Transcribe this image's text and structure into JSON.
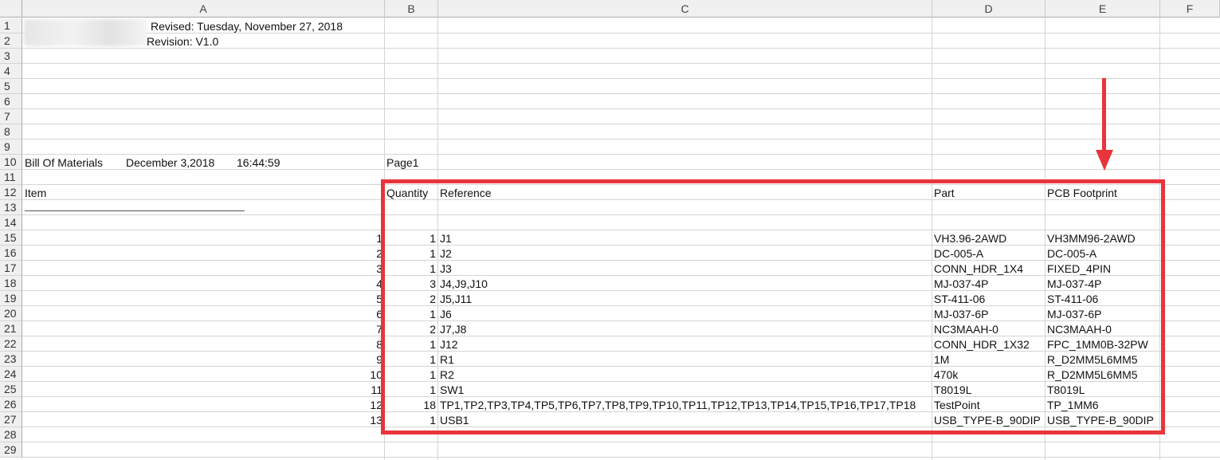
{
  "columns": [
    "A",
    "B",
    "C",
    "D",
    "E",
    "F"
  ],
  "row_numbers": [
    "1",
    "2",
    "3",
    "4",
    "5",
    "6",
    "7",
    "8",
    "9",
    "10",
    "11",
    "12",
    "13",
    "14",
    "15",
    "16",
    "17",
    "18",
    "19",
    "20",
    "21",
    "22",
    "23",
    "24",
    "25",
    "26",
    "27",
    "28",
    "29"
  ],
  "header_info": {
    "revised": "Revised: Tuesday, November 27, 2018",
    "revision": "Revision: V1.0",
    "bom_title": "Bill Of Materials",
    "bom_date": "December 3,2018",
    "bom_time": "16:44:59",
    "page": "Page1"
  },
  "table_headers": {
    "item": "Item",
    "quantity": "Quantity",
    "reference": "Reference",
    "part": "Part",
    "footprint": "PCB Footprint"
  },
  "rows": [
    {
      "item": "1",
      "qty": "1",
      "ref": "J1",
      "part": "VH3.96-2AWD",
      "fp": "VH3MM96-2AWD"
    },
    {
      "item": "2",
      "qty": "1",
      "ref": "J2",
      "part": "DC-005-A",
      "fp": "DC-005-A"
    },
    {
      "item": "3",
      "qty": "1",
      "ref": "J3",
      "part": "CONN_HDR_1X4",
      "fp": "FIXED_4PIN"
    },
    {
      "item": "4",
      "qty": "3",
      "ref": "J4,J9,J10",
      "part": "MJ-037-4P",
      "fp": "MJ-037-4P"
    },
    {
      "item": "5",
      "qty": "2",
      "ref": "J5,J11",
      "part": "ST-411-06",
      "fp": "ST-411-06"
    },
    {
      "item": "6",
      "qty": "1",
      "ref": "J6",
      "part": "MJ-037-6P",
      "fp": "MJ-037-6P"
    },
    {
      "item": "7",
      "qty": "2",
      "ref": "J7,J8",
      "part": "NC3MAAH-0",
      "fp": "NC3MAAH-0"
    },
    {
      "item": "8",
      "qty": "1",
      "ref": "J12",
      "part": "CONN_HDR_1X32",
      "fp": "FPC_1MM0B-32PW"
    },
    {
      "item": "9",
      "qty": "1",
      "ref": "R1",
      "part": "1M",
      "fp": "R_D2MM5L6MM5"
    },
    {
      "item": "10",
      "qty": "1",
      "ref": "R2",
      "part": "470k",
      "fp": "R_D2MM5L6MM5"
    },
    {
      "item": "11",
      "qty": "1",
      "ref": "SW1",
      "part": "T8019L",
      "fp": "T8019L"
    },
    {
      "item": "12",
      "qty": "18",
      "ref": "TP1,TP2,TP3,TP4,TP5,TP6,TP7,TP8,TP9,TP10,TP11,TP12,TP13,TP14,TP15,TP16,TP17,TP18",
      "part": "TestPoint",
      "fp": "TP_1MM6"
    },
    {
      "item": "13",
      "qty": "1",
      "ref": "USB1",
      "part": "USB_TYPE-B_90DIP",
      "fp": "USB_TYPE-B_90DIP"
    }
  ],
  "annotation_color": "#e8353b"
}
